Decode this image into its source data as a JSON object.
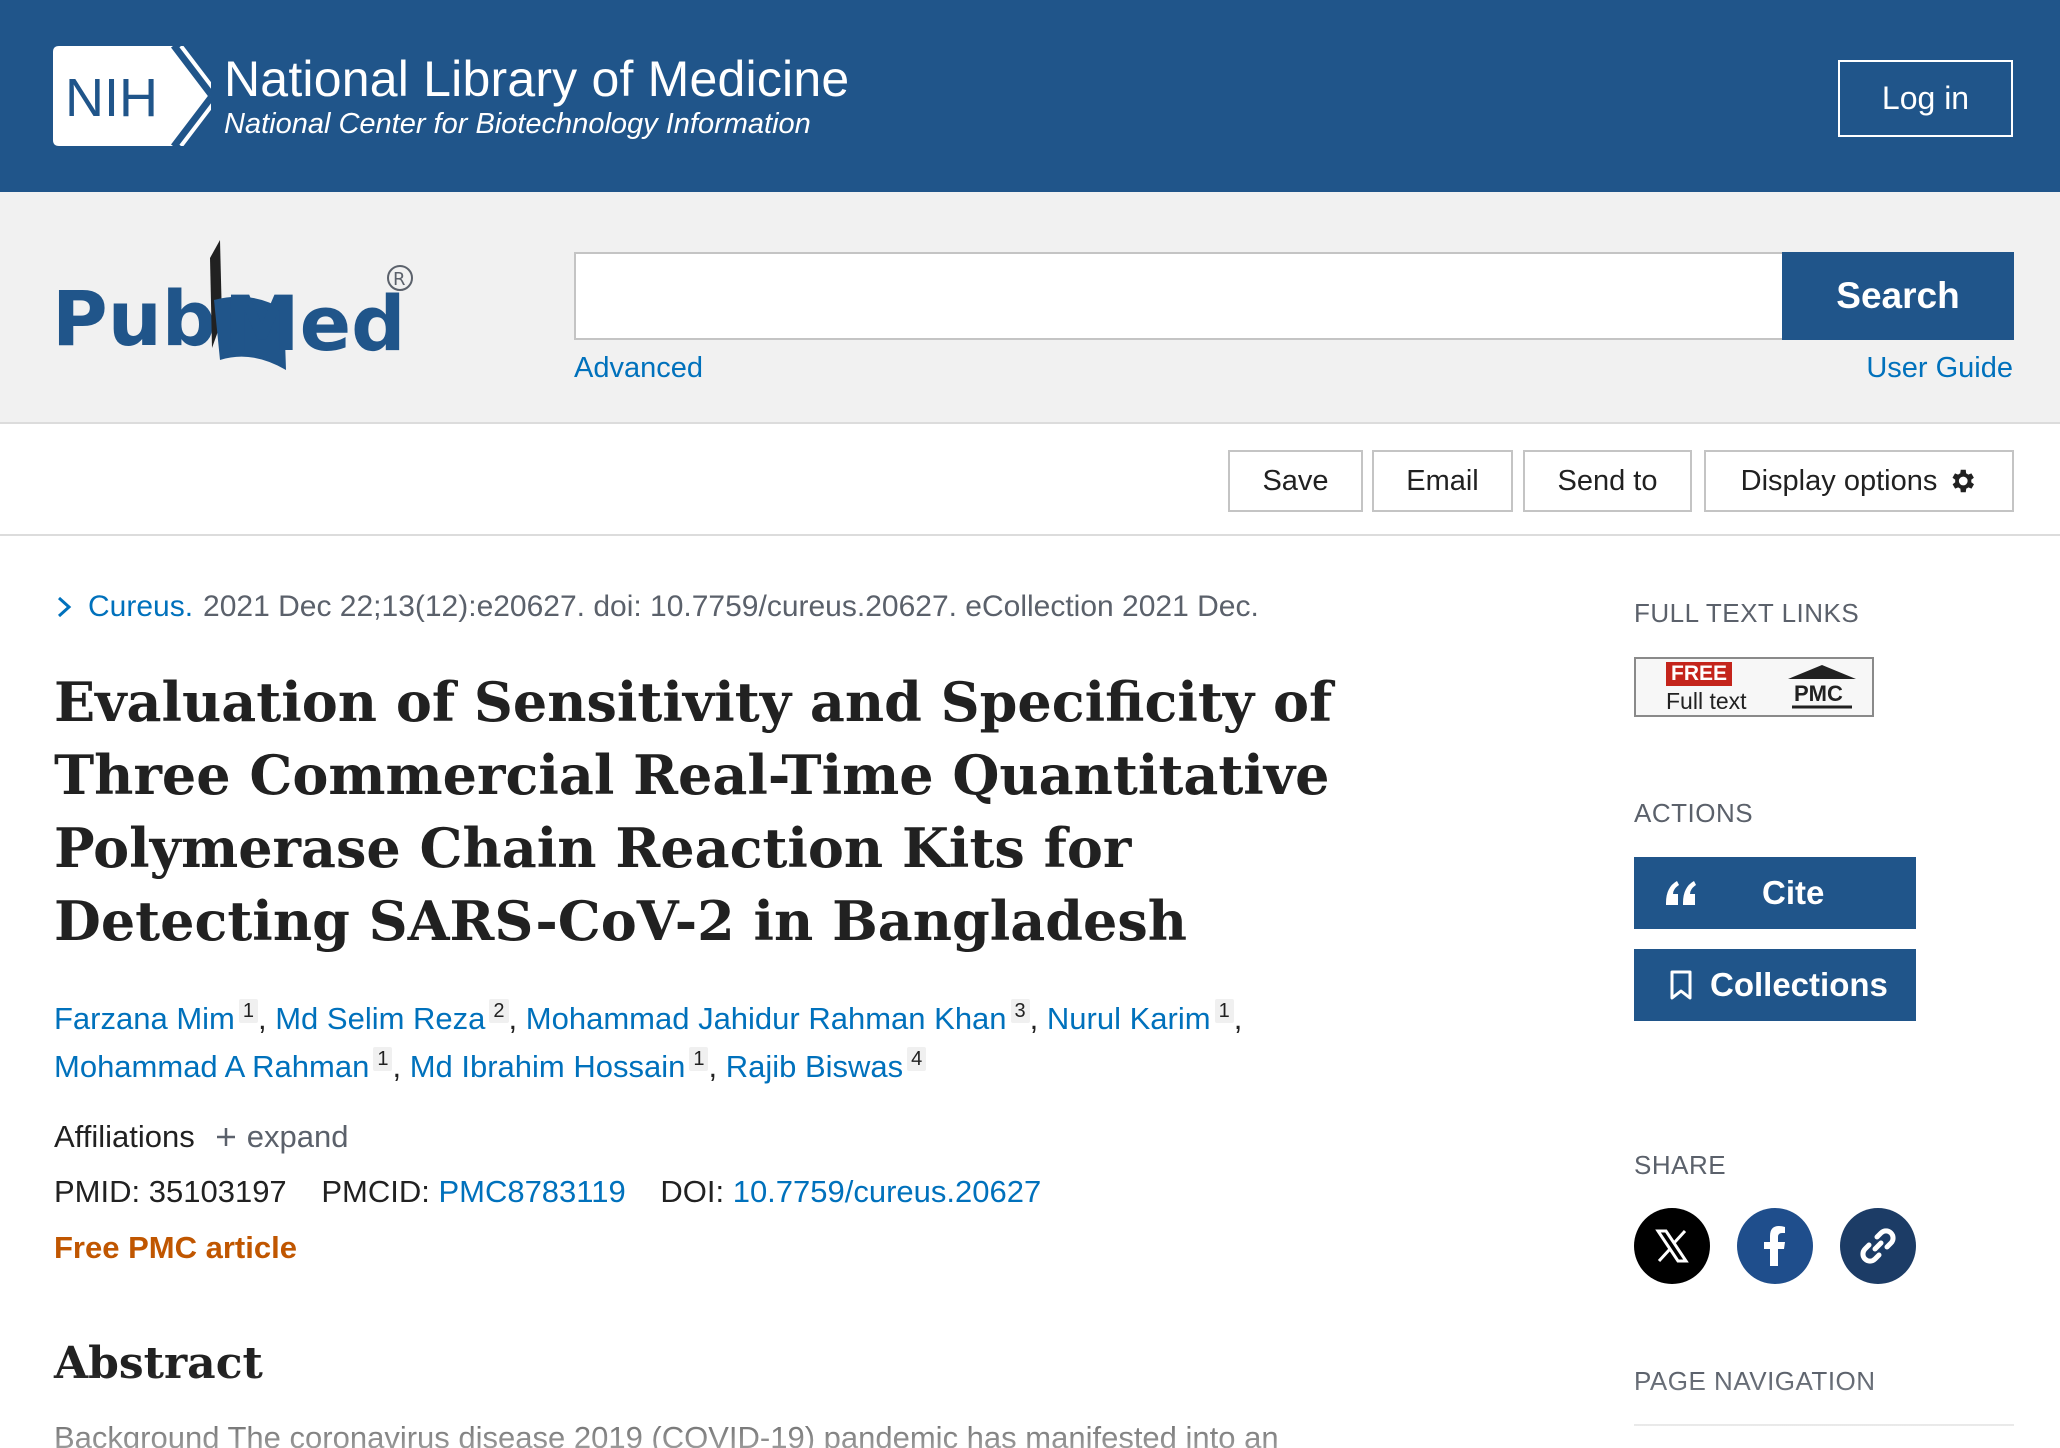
{
  "header": {
    "logo_text": "NIH",
    "title": "National Library of Medicine",
    "subtitle": "National Center for Biotechnology Information",
    "login_label": "Log in",
    "colors": {
      "bar": "#20558a",
      "text": "#ffffff"
    }
  },
  "search": {
    "brand": "PubMed®",
    "brand_parts": [
      "Pub",
      "Med"
    ],
    "query_value": "",
    "button_label": "Search",
    "advanced_label": "Advanced",
    "user_guide_label": "User Guide"
  },
  "toolbar": {
    "save_label": "Save",
    "email_label": "Email",
    "send_to_label": "Send to",
    "display_options_label": "Display options",
    "display_options_icon": "gear-icon"
  },
  "article": {
    "journal": "Cureus.",
    "citation_rest": "2021 Dec 22;13(12):e20627. doi: 10.7759/cureus.20627. eCollection 2021 Dec.",
    "title": "Evaluation of Sensitivity and Specificity of Three Commercial Real-Time Quantitative Polymerase Chain Reaction Kits for Detecting SARS-CoV-2 in Bangladesh",
    "authors": [
      {
        "name": "Farzana Mim",
        "aff": "1"
      },
      {
        "name": "Md Selim Reza",
        "aff": "2"
      },
      {
        "name": "Mohammad Jahidur Rahman Khan",
        "aff": "3"
      },
      {
        "name": "Nurul Karim",
        "aff": "1"
      },
      {
        "name": "Mohammad A Rahman",
        "aff": "1"
      },
      {
        "name": "Md Ibrahim Hossain",
        "aff": "1"
      },
      {
        "name": "Rajib Biswas",
        "aff": "4"
      }
    ],
    "affiliations_label": "Affiliations",
    "expand_label": "expand",
    "pmid_label": "PMID:",
    "pmid": "35103197",
    "pmcid_label": "PMCID:",
    "pmcid": "PMC8783119",
    "doi_label": "DOI:",
    "doi": "10.7759/cureus.20627",
    "free_pmc_label": "Free PMC article",
    "abstract_heading": "Abstract",
    "abstract_first_line": "Background The coronavirus disease 2019 (COVID-19) pandemic has manifested into an"
  },
  "sidebar": {
    "full_text_links_heading": "FULL TEXT LINKS",
    "badge_free": "FREE",
    "badge_full_text": "Full text",
    "badge_pmc": "PMC",
    "actions_heading": "ACTIONS",
    "cite_label": "Cite",
    "collections_label": "Collections",
    "share_heading": "SHARE",
    "share_icons": [
      "x-icon",
      "facebook-icon",
      "link-icon"
    ],
    "page_navigation_heading": "PAGE NAVIGATION"
  },
  "colors": {
    "link": "#0071bc",
    "accent_orange": "#c05600",
    "brand_blue": "#20558a"
  }
}
